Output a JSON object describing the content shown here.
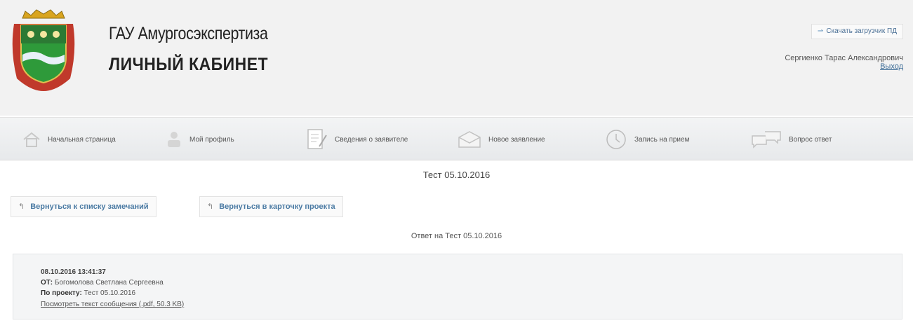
{
  "header": {
    "org_name": "ГАУ Амургосэкспертиза",
    "cabinet_title": "ЛИЧНЫЙ КАБИНЕТ",
    "download_label": "Скачать загрузчик ПД",
    "user_name": "Сергиенко Тарас Александрович",
    "logout_label": "Выход"
  },
  "nav": [
    {
      "label": "Начальная страница",
      "icon": "home-icon"
    },
    {
      "label": "Мой профиль",
      "icon": "user-icon"
    },
    {
      "label": "Сведения о заявителе",
      "icon": "document-edit-icon"
    },
    {
      "label": "Новое заявление",
      "icon": "envelope-icon"
    },
    {
      "label": "Запись на прием",
      "icon": "clock-icon"
    },
    {
      "label": "Вопрос ответ",
      "icon": "chat-icon"
    }
  ],
  "page": {
    "title": "Тест 05.10.2016",
    "back_to_remarks": "Вернуться к списку замечаний",
    "back_to_project": "Вернуться в карточку проекта",
    "subtitle": "Ответ на Тест 05.10.2016"
  },
  "message": {
    "datetime": "08.10.2016 13:41:37",
    "from_label": "ОТ:",
    "from_value": "Богомолова Светлана Сергеевна",
    "project_label": "По проекту:",
    "project_value": "Тест 05.10.2016",
    "view_link": "Посмотреть текст сообщения (.pdf, 50.3 KB)"
  },
  "colors": {
    "link": "#4a7aa3",
    "header_bg": "#f2f2f2"
  }
}
